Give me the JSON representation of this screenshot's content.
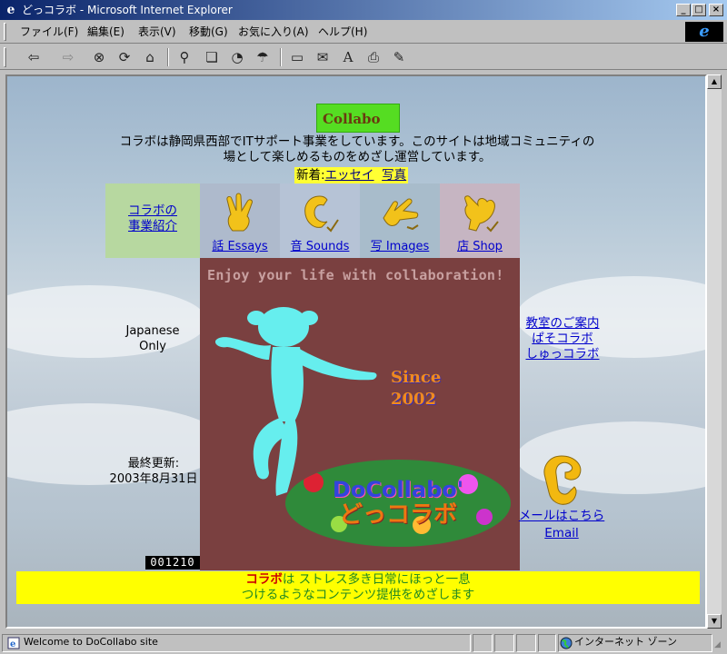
{
  "window": {
    "title": "どっコラボ - Microsoft Internet Explorer",
    "icon": "ie-icon",
    "minimize": "_",
    "maximize": "□",
    "close": "×"
  },
  "menu": {
    "items": [
      "ファイル(F)",
      "編集(E)",
      "表示(V)",
      "移動(G)",
      "お気に入り(A)",
      "ヘルプ(H)"
    ]
  },
  "toolbar": {
    "back": "⇦",
    "forward": "⇨",
    "stop": "⊗",
    "refresh": "⟳",
    "home": "⌂",
    "search": "⚲",
    "favorites": "❏",
    "history": "◔",
    "channels": "☂",
    "fullscreen": "▭",
    "mail": "✉",
    "font": "A",
    "print": "⎙",
    "edit": "✎"
  },
  "page": {
    "logo_text": "Collabo",
    "intro_line1": "コラボは静岡県西部でITサポート事業をしています。このサイトは地域コミュニティの",
    "intro_line2": "場として楽しめるものをめざし運営しています。",
    "news_prefix": "新着:",
    "news_links": [
      "エッセイ",
      "写真"
    ],
    "nav": [
      {
        "label_line1": "コラボの",
        "label_line2": "事業紹介",
        "color": "#b7d8a0"
      },
      {
        "label": "話 Essays",
        "color": "#aebacc"
      },
      {
        "label": "音 Sounds",
        "color": "#b6c3d6"
      },
      {
        "label": "写 Images",
        "color": "#a8bccb"
      },
      {
        "label": "店 Shop",
        "color": "#c6b5c2"
      }
    ],
    "hero_slogan": "Enjoy your life with collaboration!",
    "since_line1": "Since",
    "since_line2": "2002",
    "hero_logo_en": "DoCollabo'",
    "hero_logo_ja": "どっコラボ",
    "japanese_only_1": "Japanese",
    "japanese_only_2": "Only",
    "updated_label": "最終更新:",
    "updated_date": "2003年8月31日",
    "counter": "001210",
    "right_links": [
      "教室のご案内",
      "ぱそコラボ",
      "しゅっコラボ"
    ],
    "mail_link": "メールはこちら",
    "email_link": "Email",
    "banner_brand": "コラボ",
    "banner_line1_rest": "は ストレス多き日常にほっと一息",
    "banner_line2": "つけるようなコンテンツ提供をめざします"
  },
  "status": {
    "text": "Welcome to DoCollabo site",
    "zone": "インターネット ゾーン"
  }
}
